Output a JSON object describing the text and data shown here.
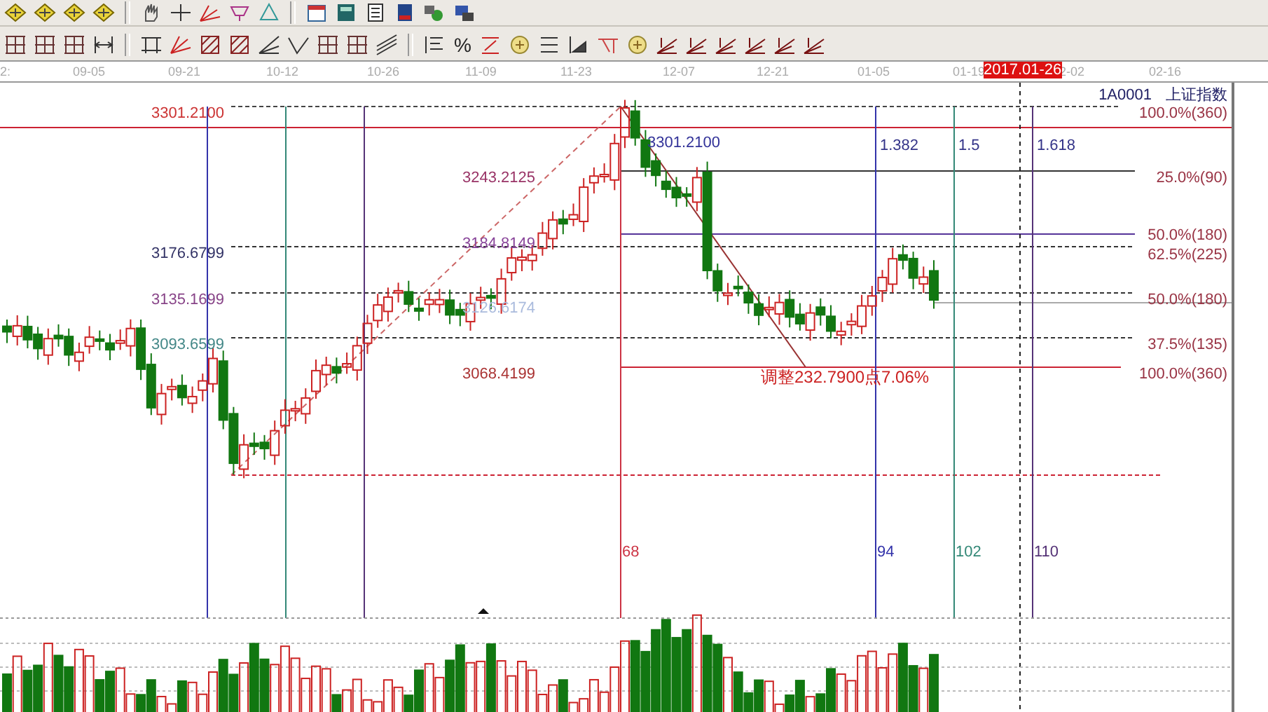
{
  "toolbar": {
    "percent_label": "%"
  },
  "date_axis": [
    {
      "label": "2:",
      "selected": false
    },
    {
      "label": "09-05",
      "selected": false
    },
    {
      "label": "09-21",
      "selected": false
    },
    {
      "label": "10-12",
      "selected": false
    },
    {
      "label": "10-26",
      "selected": false
    },
    {
      "label": "11-09",
      "selected": false
    },
    {
      "label": "11-23",
      "selected": false
    },
    {
      "label": "12-07",
      "selected": false
    },
    {
      "label": "12-21",
      "selected": false
    },
    {
      "label": "01-05",
      "selected": false
    },
    {
      "label": "01-19",
      "selected": false
    },
    {
      "label": "2017.01-26",
      "selected": true
    },
    {
      "label": "2-02",
      "selected": false
    },
    {
      "label": "02-16",
      "selected": false
    }
  ],
  "symbol": {
    "code": "1A0001",
    "name": "上证指数"
  },
  "price_labels": [
    {
      "text": "3301.2100",
      "color": "#cc3333"
    },
    {
      "text": "3176.6799",
      "color": "#333366"
    },
    {
      "text": "3135.1699",
      "color": "#884488"
    },
    {
      "text": "3093.6599",
      "color": "#448888"
    },
    {
      "text": "3301.2100",
      "color": "#333399"
    },
    {
      "text": "3243.2125",
      "color": "#993366"
    },
    {
      "text": "3184.8149",
      "color": "#884499"
    },
    {
      "text": "3126.6174",
      "color": "#aabbdd"
    },
    {
      "text": "3068.4199",
      "color": "#aa3333"
    }
  ],
  "fib_ratios": [
    "1.382",
    "1.5",
    "1.618"
  ],
  "percent_levels": [
    "100.0%(360)",
    "25.0%(90)",
    "50.0%(180)",
    "62.5%(225)",
    "50.0%(180)",
    "37.5%(135)",
    "100.0%(360)"
  ],
  "range_annotation": "调整232.7900点7.06%",
  "time_counts": [
    "68",
    "94",
    "102",
    "110"
  ]
}
